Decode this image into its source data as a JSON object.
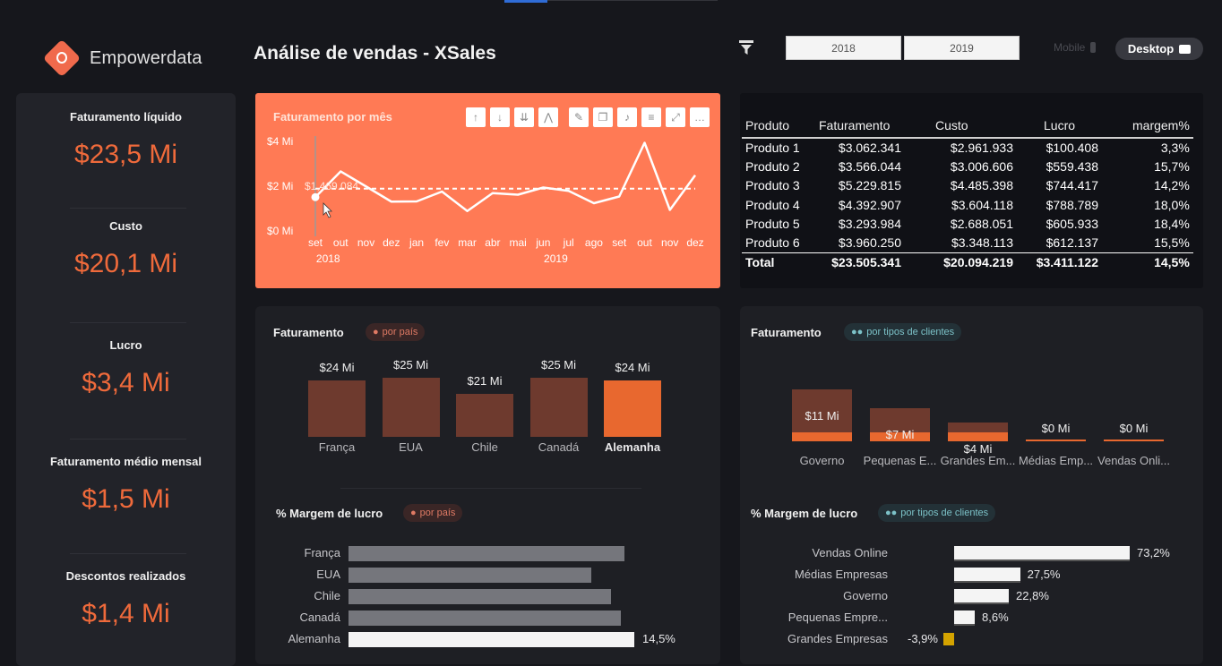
{
  "brand": {
    "name": "Empowerdata"
  },
  "page_title": "Análise de vendas - XSales",
  "filters": {
    "years": [
      "2018",
      "2019"
    ]
  },
  "view_toggle": {
    "mobile": "Mobile",
    "desktop": "Desktop"
  },
  "kpis": [
    {
      "label": "Faturamento líquido",
      "value": "$23,5 Mi"
    },
    {
      "label": "Custo",
      "value": "$20,1 Mi"
    },
    {
      "label": "Lucro",
      "value": "$3,4 Mi"
    },
    {
      "label": "Faturamento médio mensal",
      "value": "$1,5 Mi"
    },
    {
      "label": "Descontos realizados",
      "value": "$1,4 Mi"
    }
  ],
  "line_chart": {
    "title": "Faturamento por mês",
    "tooltip": "$1,469.084",
    "y_ticks": [
      "$4 Mi",
      "$2 Mi",
      "$0 Mi"
    ],
    "months": [
      "set",
      "out",
      "nov",
      "dez",
      "jan",
      "fev",
      "mar",
      "abr",
      "mai",
      "jun",
      "jul",
      "ago",
      "set",
      "out",
      "nov",
      "dez"
    ],
    "year_labels": [
      "2018",
      "2019"
    ],
    "values": [
      1.47,
      2.62,
      1.95,
      1.27,
      1.28,
      1.72,
      0.85,
      1.65,
      1.58,
      1.9,
      1.75,
      1.2,
      1.5,
      3.9,
      0.9,
      2.45
    ],
    "average": 1.85,
    "ylim": [
      0,
      4
    ]
  },
  "product_table": {
    "headers": [
      "Produto",
      "Faturamento",
      "Custo",
      "Lucro",
      "margem%"
    ],
    "rows": [
      [
        "Produto 1",
        "$3.062.341",
        "$2.961.933",
        "$100.408",
        "3,3%"
      ],
      [
        "Produto 2",
        "$3.566.044",
        "$3.006.606",
        "$559.438",
        "15,7%"
      ],
      [
        "Produto 3",
        "$5.229.815",
        "$4.485.398",
        "$744.417",
        "14,2%"
      ],
      [
        "Produto 4",
        "$4.392.907",
        "$3.604.118",
        "$788.789",
        "18,0%"
      ],
      [
        "Produto 5",
        "$3.293.984",
        "$2.688.051",
        "$605.933",
        "18,4%"
      ],
      [
        "Produto 6",
        "$3.960.250",
        "$3.348.113",
        "$612.137",
        "15,5%"
      ]
    ],
    "total": [
      "Total",
      "$23.505.341",
      "$20.094.219",
      "$3.411.122",
      "14,5%"
    ]
  },
  "country_revenue": {
    "title": "Faturamento",
    "pill": "por país",
    "categories": [
      "França",
      "EUA",
      "Chile",
      "Canadá",
      "Alemanha"
    ],
    "labels": [
      "$24 Mi",
      "$25 Mi",
      "$21 Mi",
      "$25 Mi",
      "$24 Mi"
    ],
    "values": [
      24,
      25,
      21,
      25,
      24
    ],
    "highlight_index": 4,
    "colors": {
      "normal": "#6e3a2e",
      "highlight": "#e8682f"
    }
  },
  "client_revenue": {
    "title": "Faturamento",
    "pill": "por tipos de clientes",
    "categories": [
      "Governo",
      "Pequenas E...",
      "Grandes Em...",
      "Médias Emp...",
      "Vendas Onli..."
    ],
    "labels": [
      "$11 Mi",
      "$7 Mi",
      "$4 Mi",
      "$0 Mi",
      "$0 Mi"
    ],
    "values": [
      11,
      7,
      4,
      0,
      0
    ]
  },
  "country_margin": {
    "title": "% Margem de lucro",
    "pill": "por país",
    "categories": [
      "França",
      "EUA",
      "Chile",
      "Canadá",
      "Alemanha"
    ],
    "values": [
      14.0,
      12.3,
      13.3,
      13.8,
      14.5
    ],
    "value_label": "14,5%",
    "labeled_index": 4
  },
  "client_margin": {
    "title": "% Margem de lucro",
    "pill": "por tipos de clientes",
    "categories": [
      "Vendas Online",
      "Médias Empresas",
      "Governo",
      "Pequenas Empre...",
      "Grandes Empresas"
    ],
    "values": [
      73.2,
      27.5,
      22.8,
      8.6,
      -3.9
    ],
    "labels": [
      "73,2%",
      "27,5%",
      "22,8%",
      "8,6%",
      "-3,9%"
    ]
  }
}
